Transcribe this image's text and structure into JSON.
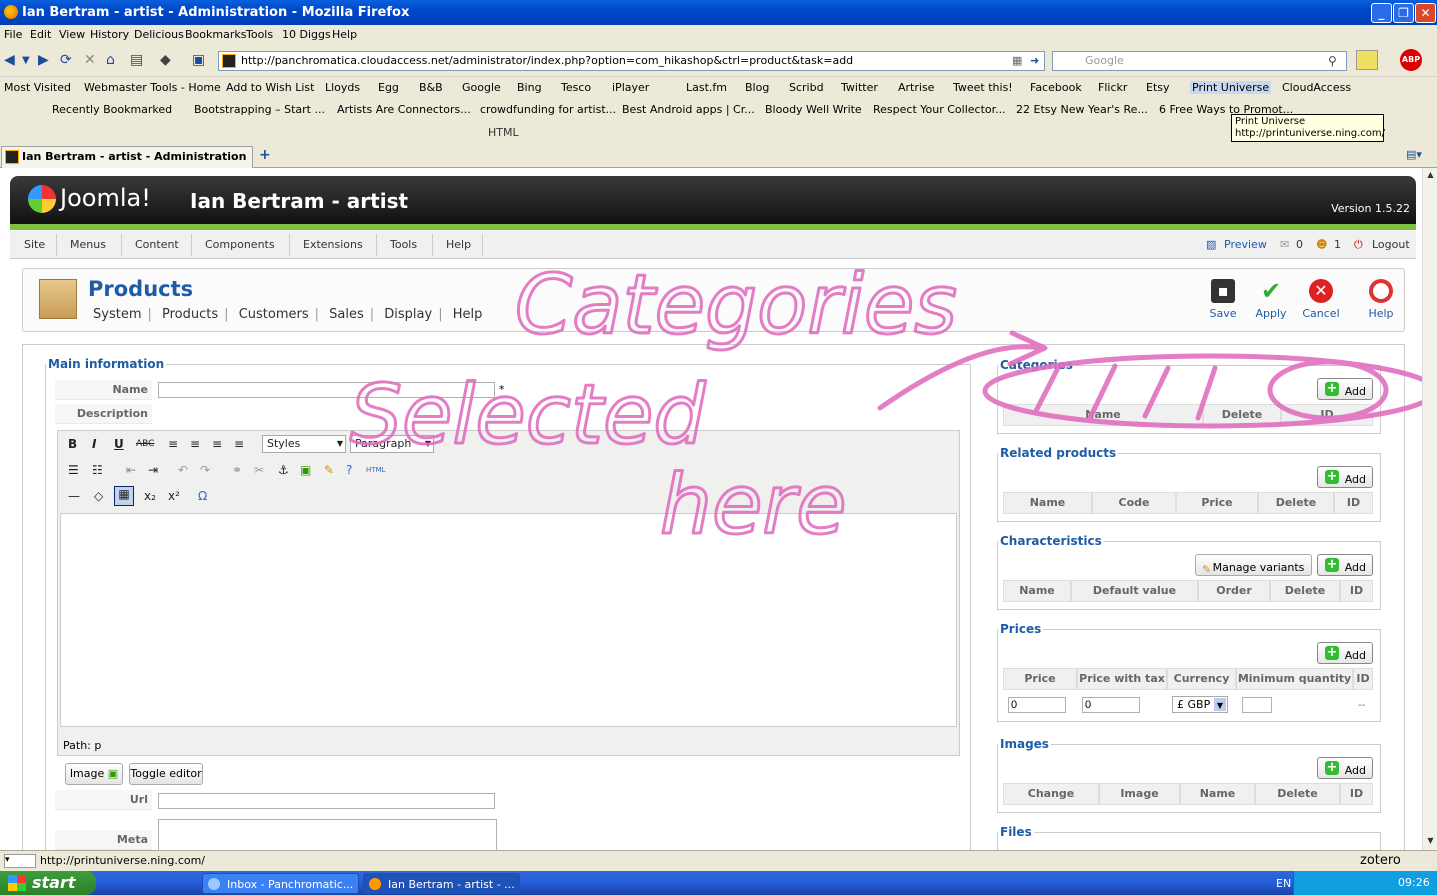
{
  "window": {
    "title": "Ian Bertram - artist - Administration - Mozilla Firefox"
  },
  "menubar": [
    "File",
    "Edit",
    "View",
    "History",
    "Delicious",
    "Bookmarks",
    "Tools",
    "10 Diggs",
    "Help"
  ],
  "nav": {
    "url": "http://panchromatica.cloudaccess.net/administrator/index.php?option=com_hikashop&ctrl=product&task=add",
    "search_placeholder": "Google"
  },
  "bookmarks1": [
    "Most Visited",
    "Webmaster Tools - Home",
    "Add to Wish List",
    "Lloyds",
    "Egg",
    "B&B",
    "Google",
    "Bing",
    "Tesco",
    "iPlayer",
    "Last.fm",
    "Blog",
    "Scribd",
    "Twitter",
    "Artrise",
    "Tweet this!",
    "Facebook",
    "Flickr",
    "Etsy",
    "Print Universe",
    "CloudAccess"
  ],
  "bookmarks2": [
    "Recently Bookmarked",
    "Bootstrapping – Start ...",
    "Artists Are Connectors...",
    "crowdfunding for artist...",
    "Best Android apps | Cr...",
    "Bloody Well Write",
    "Respect Your Collector...",
    "22 Etsy New Year's Re...",
    "6 Free Ways to Promot..."
  ],
  "tinybar": {
    "html_label": "HTML"
  },
  "tooltip": {
    "line1": "Print Universe",
    "line2": "http://printuniverse.ning.com/"
  },
  "tab": {
    "label": "Ian Bertram - artist - Administration"
  },
  "joomla": {
    "logo": "Joomla!",
    "site": "Ian Bertram - artist",
    "version": "Version 1.5.22",
    "menu": [
      "Site",
      "Menus",
      "Content",
      "Components",
      "Extensions",
      "Tools",
      "Help"
    ],
    "status": {
      "preview": "Preview",
      "messages": "0",
      "users": "1",
      "logout": "Logout"
    }
  },
  "page": {
    "title": "Products",
    "subnav": [
      "System",
      "Products",
      "Customers",
      "Sales",
      "Display",
      "Help"
    ],
    "buttons": [
      "Save",
      "Apply",
      "Cancel",
      "Help"
    ]
  },
  "main": {
    "legend": "Main information",
    "name_label": "Name",
    "required": "*",
    "desc_label": "Description",
    "styles": "Styles",
    "paragraph": "Paragraph",
    "path": "Path: p",
    "image_btn": "Image",
    "toggle_btn": "Toggle editor",
    "url_label": "Url",
    "meta_label": "Meta description"
  },
  "categories": {
    "legend": "Categories",
    "add": "Add",
    "cols": [
      "Name",
      "Delete",
      "ID"
    ]
  },
  "related": {
    "legend": "Related products",
    "add": "Add",
    "cols": [
      "Name",
      "Code",
      "Price",
      "Delete",
      "ID"
    ]
  },
  "characteristics": {
    "legend": "Characteristics",
    "manage": "Manage variants",
    "add": "Add",
    "cols": [
      "Name",
      "Default value",
      "Order",
      "Delete",
      "ID"
    ]
  },
  "prices": {
    "legend": "Prices",
    "add": "Add",
    "cols": [
      "Price",
      "Price with tax",
      "Currency",
      "Minimum quantity",
      "ID"
    ],
    "row": {
      "price": "0",
      "price_tax": "0",
      "currency": "£ GBP",
      "min_qty": "",
      "id": "--"
    }
  },
  "images": {
    "legend": "Images",
    "add": "Add",
    "cols": [
      "Change",
      "Image",
      "Name",
      "Delete",
      "ID"
    ]
  },
  "files": {
    "legend": "Files"
  },
  "annotation": {
    "line1": "Categories",
    "line2": "Selected",
    "line3": "here"
  },
  "statusbar": {
    "url": "http://printuniverse.ning.com/",
    "zotero": "zotero"
  },
  "taskbar": {
    "start": "start",
    "tasks": [
      "Inbox - Panchromatic...",
      "Ian Bertram - artist - ..."
    ],
    "lang": "EN",
    "time": "09:26"
  }
}
